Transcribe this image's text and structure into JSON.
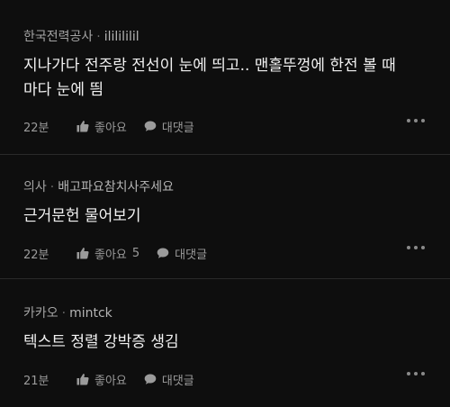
{
  "comments": [
    {
      "company": "한국전력공사",
      "separator": "·",
      "nickname": "ililililil",
      "body_line1": "지나가다 전주랑 전선이 눈에 띄고.. 맨홀뚜껑에 한전 볼 때",
      "body_line2": "마다 눈에 띔",
      "time": "22분",
      "like_label": "좋아요",
      "like_count": "",
      "reply_label": "대댓글"
    },
    {
      "company": "의사",
      "separator": "·",
      "nickname": "배고파요참치사주세요",
      "body_line1": "근거문헌 물어보기",
      "body_line2": "",
      "time": "22분",
      "like_label": "좋아요",
      "like_count": "5",
      "reply_label": "대댓글"
    },
    {
      "company": "카카오",
      "separator": "·",
      "nickname": "mintck",
      "body_line1": "텍스트 정렬 강박증 생김",
      "body_line2": "",
      "time": "21분",
      "like_label": "좋아요",
      "like_count": "",
      "reply_label": "대댓글"
    }
  ],
  "icons": {
    "like": "thumbs-up-icon",
    "reply": "speech-bubble-icon",
    "more": "more-dots-icon"
  },
  "colors": {
    "background": "#0e0e0e",
    "divider": "#2a2a2a",
    "body_text": "#f2f2f2",
    "meta_text": "#a3a3a3",
    "action_text": "#9b9b9b"
  }
}
